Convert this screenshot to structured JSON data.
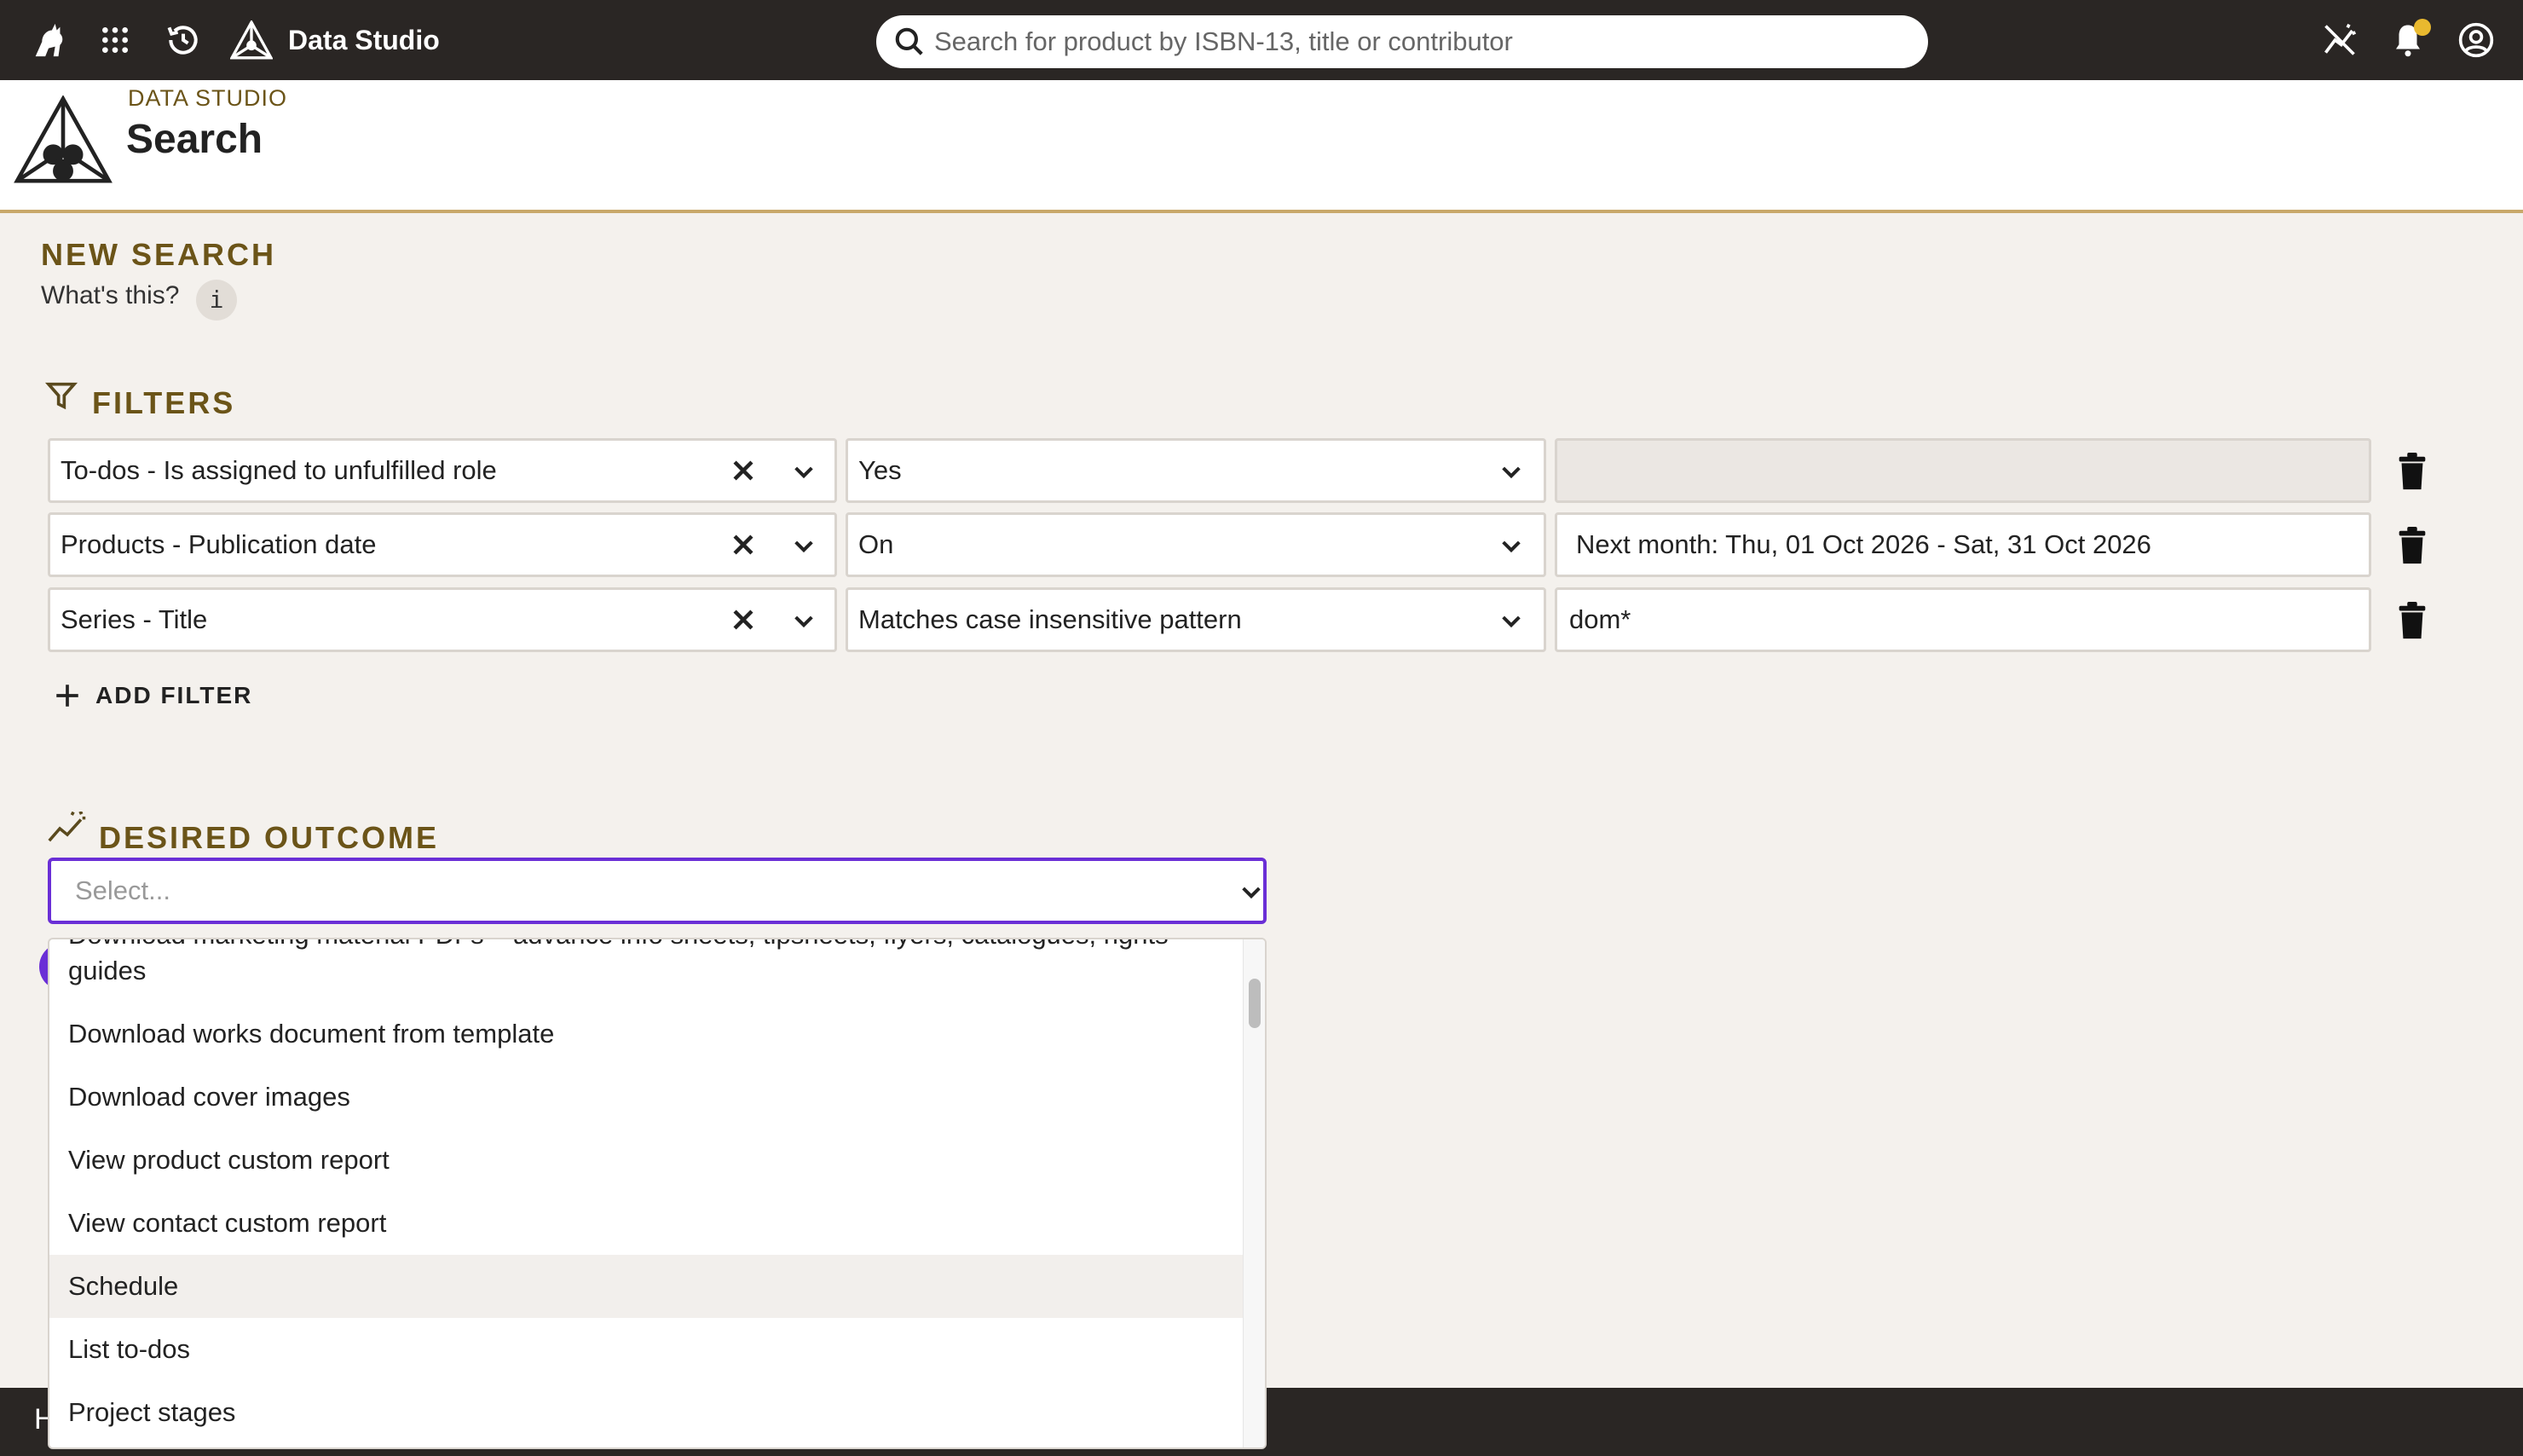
{
  "topbar": {
    "app_name": "Data Studio",
    "search_placeholder": "Search for product by ISBN-13, title or contributor"
  },
  "header": {
    "kicker": "DATA STUDIO",
    "title": "Search"
  },
  "new_search": {
    "title": "NEW SEARCH",
    "help_text": "What's this?",
    "info_badge": "i"
  },
  "filters": {
    "title": "FILTERS",
    "rows": [
      {
        "field": "To-dos - Is assigned to unfulfilled role",
        "operator": "Yes",
        "value": ""
      },
      {
        "field": "Products - Publication date",
        "operator": "On",
        "value": "Next month: Thu, 01 Oct 2026 - Sat, 31 Oct 2026"
      },
      {
        "field": "Series - Title",
        "operator": "Matches case insensitive pattern",
        "value": "dom*"
      }
    ],
    "add_label": "ADD FILTER"
  },
  "desired_outcome": {
    "title": "DESIRED OUTCOME",
    "placeholder": "Select...",
    "options": [
      "Download marketing material PDFs – advance info sheets, tipsheets, flyers, catalogues, rights guides",
      "Download works document from template",
      "Download cover images",
      "View product custom report",
      "View contact custom report",
      "Schedule",
      "List to-dos",
      "Project stages"
    ],
    "highlighted": "Schedule"
  },
  "footer": {
    "text": "H"
  },
  "colors": {
    "topbar": "#2a2624",
    "accent_gold": "#6b5418",
    "focus_purple": "#6a2fd6",
    "header_rule": "#c8a86a",
    "notification_dot": "#e9b92f"
  },
  "icons": [
    "cat-logo-icon",
    "apps-grid-icon",
    "history-icon",
    "data-studio-logo-icon",
    "search-icon",
    "analytics-off-icon",
    "bell-icon",
    "account-icon",
    "info-icon",
    "filter-icon",
    "clear-icon",
    "chevron-down-icon",
    "trash-icon",
    "plus-icon",
    "trend-icon"
  ]
}
